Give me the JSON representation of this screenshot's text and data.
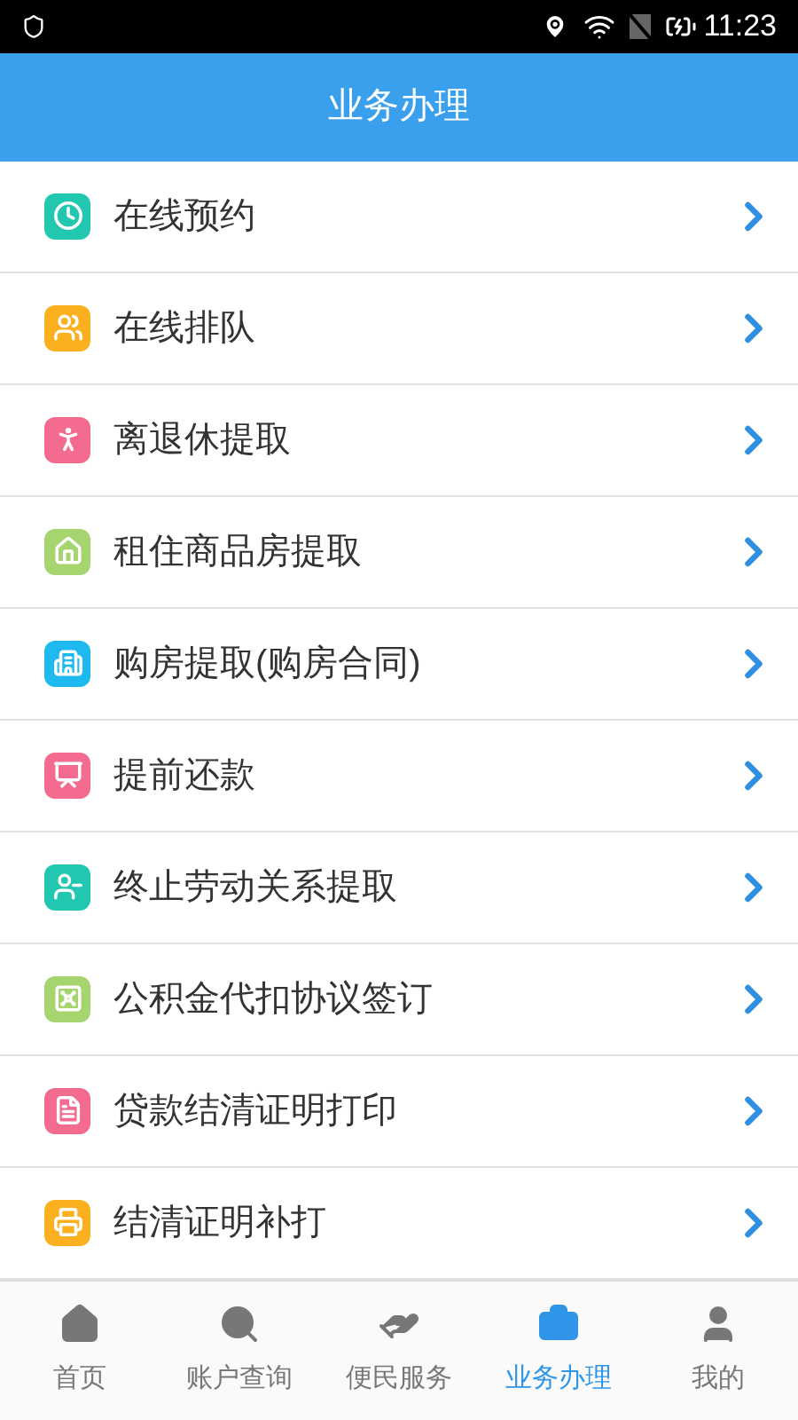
{
  "status_bar": {
    "time": "11:23"
  },
  "header": {
    "title": "业务办理"
  },
  "items": [
    {
      "label": "在线预约",
      "color": "#22c7b0",
      "kind": "clock"
    },
    {
      "label": "在线排队",
      "color": "#fbb020",
      "kind": "people"
    },
    {
      "label": "离退休提取",
      "color": "#f36b8e",
      "kind": "elder"
    },
    {
      "label": "租住商品房提取",
      "color": "#a6d46f",
      "kind": "house"
    },
    {
      "label": "购房提取(购房合同)",
      "color": "#1db9ef",
      "kind": "building"
    },
    {
      "label": "提前还款",
      "color": "#f36b8e",
      "kind": "desk"
    },
    {
      "label": "终止劳动关系提取",
      "color": "#22c7b0",
      "kind": "person-minus"
    },
    {
      "label": "公积金代扣协议签订",
      "color": "#a6d46f",
      "kind": "safe"
    },
    {
      "label": "贷款结清证明打印",
      "color": "#f36b8e",
      "kind": "document"
    },
    {
      "label": "结清证明补打",
      "color": "#fbb020",
      "kind": "printer"
    }
  ],
  "tabs": [
    {
      "label": "首页",
      "selected": false,
      "kind": "home"
    },
    {
      "label": "账户查询",
      "selected": false,
      "kind": "search"
    },
    {
      "label": "便民服务",
      "selected": false,
      "kind": "service"
    },
    {
      "label": "业务办理",
      "selected": true,
      "kind": "work"
    },
    {
      "label": "我的",
      "selected": false,
      "kind": "user"
    }
  ]
}
